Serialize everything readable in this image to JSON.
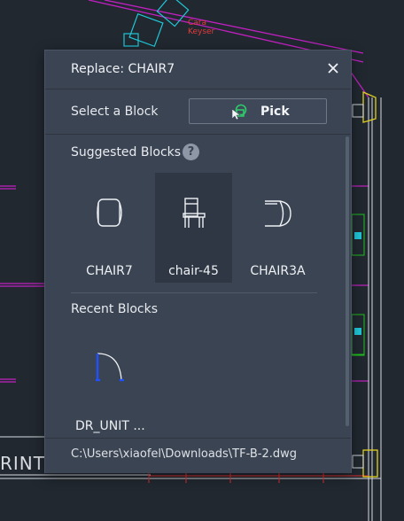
{
  "background": {
    "cad_label": "Cara\nKeyser",
    "cad_text_left": "RINTE",
    "colors": {
      "canvas": "#212830",
      "magenta": "#c020c0",
      "cyan": "#20c8d8",
      "green": "#20c020",
      "yellow": "#e0d020",
      "red": "#e03030",
      "white": "#d8dbe0"
    }
  },
  "dialog": {
    "title": "Replace: CHAIR7",
    "close_icon": "close-icon",
    "select_label": "Select a Block",
    "pick_label": "Pick",
    "pick_icon": "pick-cursor-icon",
    "suggested_label": "Suggested Blocks",
    "help_glyph": "?",
    "suggested_blocks": [
      {
        "label": "CHAIR7",
        "icon": "chair-top-view-icon",
        "selected": false
      },
      {
        "label": "chair-45",
        "icon": "chair-front-view-icon",
        "selected": true
      },
      {
        "label": "CHAIR3A",
        "icon": "chair-side-view-icon",
        "selected": false
      }
    ],
    "recent_label": "Recent Blocks",
    "recent_blocks": [
      {
        "label": "DR_UNIT ...",
        "icon": "door-swing-icon"
      }
    ],
    "file_path": "C:\\Users\\xiaofel\\Downloads\\TF-B-2.dwg"
  }
}
